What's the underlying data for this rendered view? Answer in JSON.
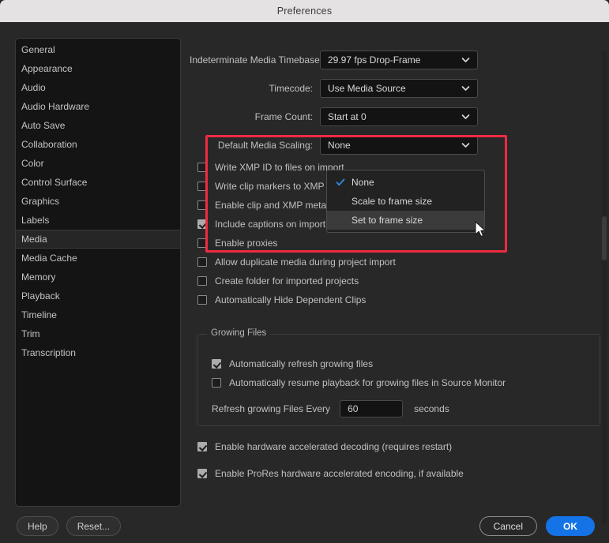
{
  "window": {
    "title": "Preferences"
  },
  "sidebar": {
    "items": [
      {
        "label": "General",
        "selected": false
      },
      {
        "label": "Appearance",
        "selected": false
      },
      {
        "label": "Audio",
        "selected": false
      },
      {
        "label": "Audio Hardware",
        "selected": false
      },
      {
        "label": "Auto Save",
        "selected": false
      },
      {
        "label": "Collaboration",
        "selected": false
      },
      {
        "label": "Color",
        "selected": false
      },
      {
        "label": "Control Surface",
        "selected": false
      },
      {
        "label": "Graphics",
        "selected": false
      },
      {
        "label": "Labels",
        "selected": false
      },
      {
        "label": "Media",
        "selected": true
      },
      {
        "label": "Media Cache",
        "selected": false
      },
      {
        "label": "Memory",
        "selected": false
      },
      {
        "label": "Playback",
        "selected": false
      },
      {
        "label": "Timeline",
        "selected": false
      },
      {
        "label": "Trim",
        "selected": false
      },
      {
        "label": "Transcription",
        "selected": false
      }
    ]
  },
  "main": {
    "selects": [
      {
        "label": "Indeterminate Media Timebase:",
        "value": "29.97 fps Drop-Frame"
      },
      {
        "label": "Timecode:",
        "value": "Use Media Source"
      },
      {
        "label": "Frame Count:",
        "value": "Start at 0"
      },
      {
        "label": "Default Media Scaling:",
        "value": "None"
      }
    ],
    "checkboxes": [
      {
        "label": "Write XMP ID to files on import",
        "checked": false
      },
      {
        "label": "Write clip markers to XMP",
        "checked": false
      },
      {
        "label": "Enable clip and XMP metadata linking",
        "checked": false
      },
      {
        "label": "Include captions on import",
        "checked": true
      },
      {
        "label": "Enable proxies",
        "checked": false
      },
      {
        "label": "Allow duplicate media during project import",
        "checked": false
      },
      {
        "label": "Create folder for imported projects",
        "checked": false
      },
      {
        "label": "Automatically Hide Dependent Clips",
        "checked": false
      }
    ],
    "growing_files": {
      "legend": "Growing Files",
      "checkboxes": [
        {
          "label": "Automatically refresh growing files",
          "checked": true
        },
        {
          "label": "Automatically resume playback for growing files in Source Monitor",
          "checked": false
        }
      ],
      "refresh_label": "Refresh growing Files Every",
      "refresh_value": "60",
      "refresh_unit": "seconds"
    },
    "hardware": [
      {
        "label": "Enable hardware accelerated decoding (requires restart)",
        "checked": true
      },
      {
        "label": "Enable ProRes hardware accelerated encoding, if available",
        "checked": true
      }
    ]
  },
  "dropdown": {
    "open": true,
    "items": [
      {
        "label": "None",
        "checked": true,
        "hover": false
      },
      {
        "label": "Scale to frame size",
        "checked": false,
        "hover": false
      },
      {
        "label": "Set to frame size",
        "checked": false,
        "hover": true
      }
    ]
  },
  "footer": {
    "help_label": "Help",
    "reset_label": "Reset...",
    "cancel_label": "Cancel",
    "ok_label": "OK"
  },
  "colors": {
    "accent_blue": "#1473e6",
    "annotation_red": "#ee2b41",
    "window_bg": "#282828",
    "titlebar_bg": "#e4e2e2"
  }
}
